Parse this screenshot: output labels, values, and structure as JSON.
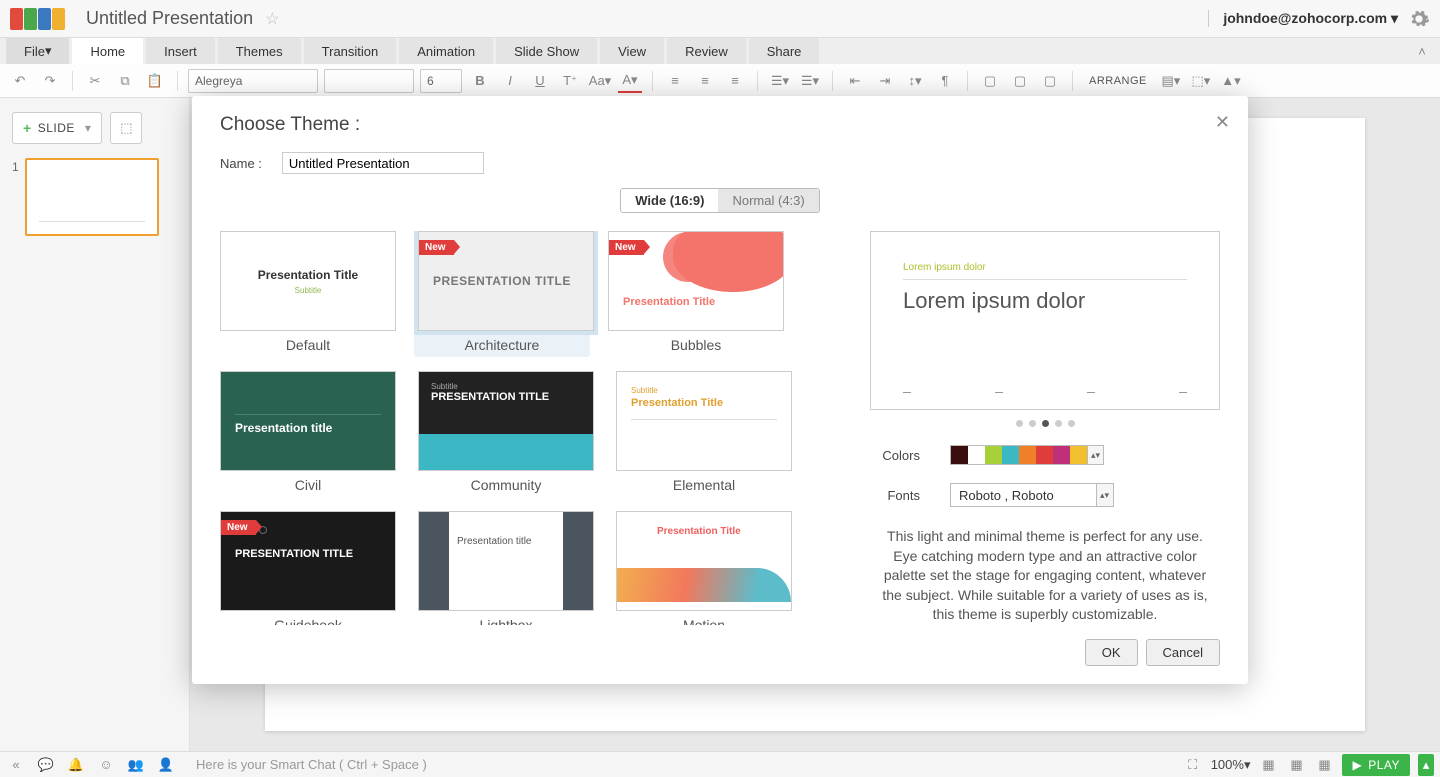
{
  "titlebar": {
    "doc_title": "Untitled Presentation",
    "user": "johndoe@zohocorp.com"
  },
  "menus": {
    "file": "File",
    "home": "Home",
    "insert": "Insert",
    "themes": "Themes",
    "transition": "Transition",
    "animation": "Animation",
    "slideshow": "Slide Show",
    "view": "View",
    "review": "Review",
    "share": "Share"
  },
  "toolbar": {
    "font_name": "Alegreya",
    "font_name2": "",
    "font_size": "6",
    "arrange": "ARRANGE"
  },
  "sidebar": {
    "slide_btn": "SLIDE",
    "thumb_num": "1"
  },
  "bottombar": {
    "chat_hint": "Here is your Smart Chat ( Ctrl + Space )",
    "zoom": "100%",
    "play": "PLAY"
  },
  "modal": {
    "title": "Choose Theme :",
    "name_label": "Name :",
    "name_value": "Untitled Presentation",
    "ratio_wide": "Wide (16:9)",
    "ratio_normal": "Normal (4:3)",
    "new_badge": "New",
    "themes": {
      "default": "Default",
      "architecture": "Architecture",
      "bubbles": "Bubbles",
      "civil": "Civil",
      "community": "Community",
      "elemental": "Elemental",
      "guidebook": "Guidebook",
      "lightbox": "Lightbox",
      "motion": "Motion"
    },
    "thumbs": {
      "default_title": "Presentation Title",
      "default_sub": "Subtitle",
      "arch_title": "PRESENTATION TITLE",
      "bubbles_title": "Presentation Title",
      "civil_title": "Presentation title",
      "comm_sub": "Subtitle",
      "comm_title": "PRESENTATION TITLE",
      "elem_sub": "Subtitle",
      "elem_title": "Presentation Title",
      "guide_title": "PRESENTATION TITLE",
      "light_title": "Presentation title",
      "motion_title": "Presentation Title"
    },
    "preview": {
      "sub": "Lorem ipsum dolor",
      "title": "Lorem ipsum dolor"
    },
    "colors_label": "Colors",
    "fonts_label": "Fonts",
    "font_value": "Roboto , Roboto",
    "swatches": [
      "#3a0e0e",
      "#ffffff",
      "#a8d03a",
      "#3bb8c4",
      "#f08028",
      "#e03c3c",
      "#c0307a",
      "#f0c030"
    ],
    "description": "This light and minimal theme is perfect for any use. Eye catching modern type and an attractive color palette set the stage for engaging content, whatever the subject. While suitable for a variety of uses as is, this theme is superbly customizable.",
    "ok": "OK",
    "cancel": "Cancel"
  }
}
